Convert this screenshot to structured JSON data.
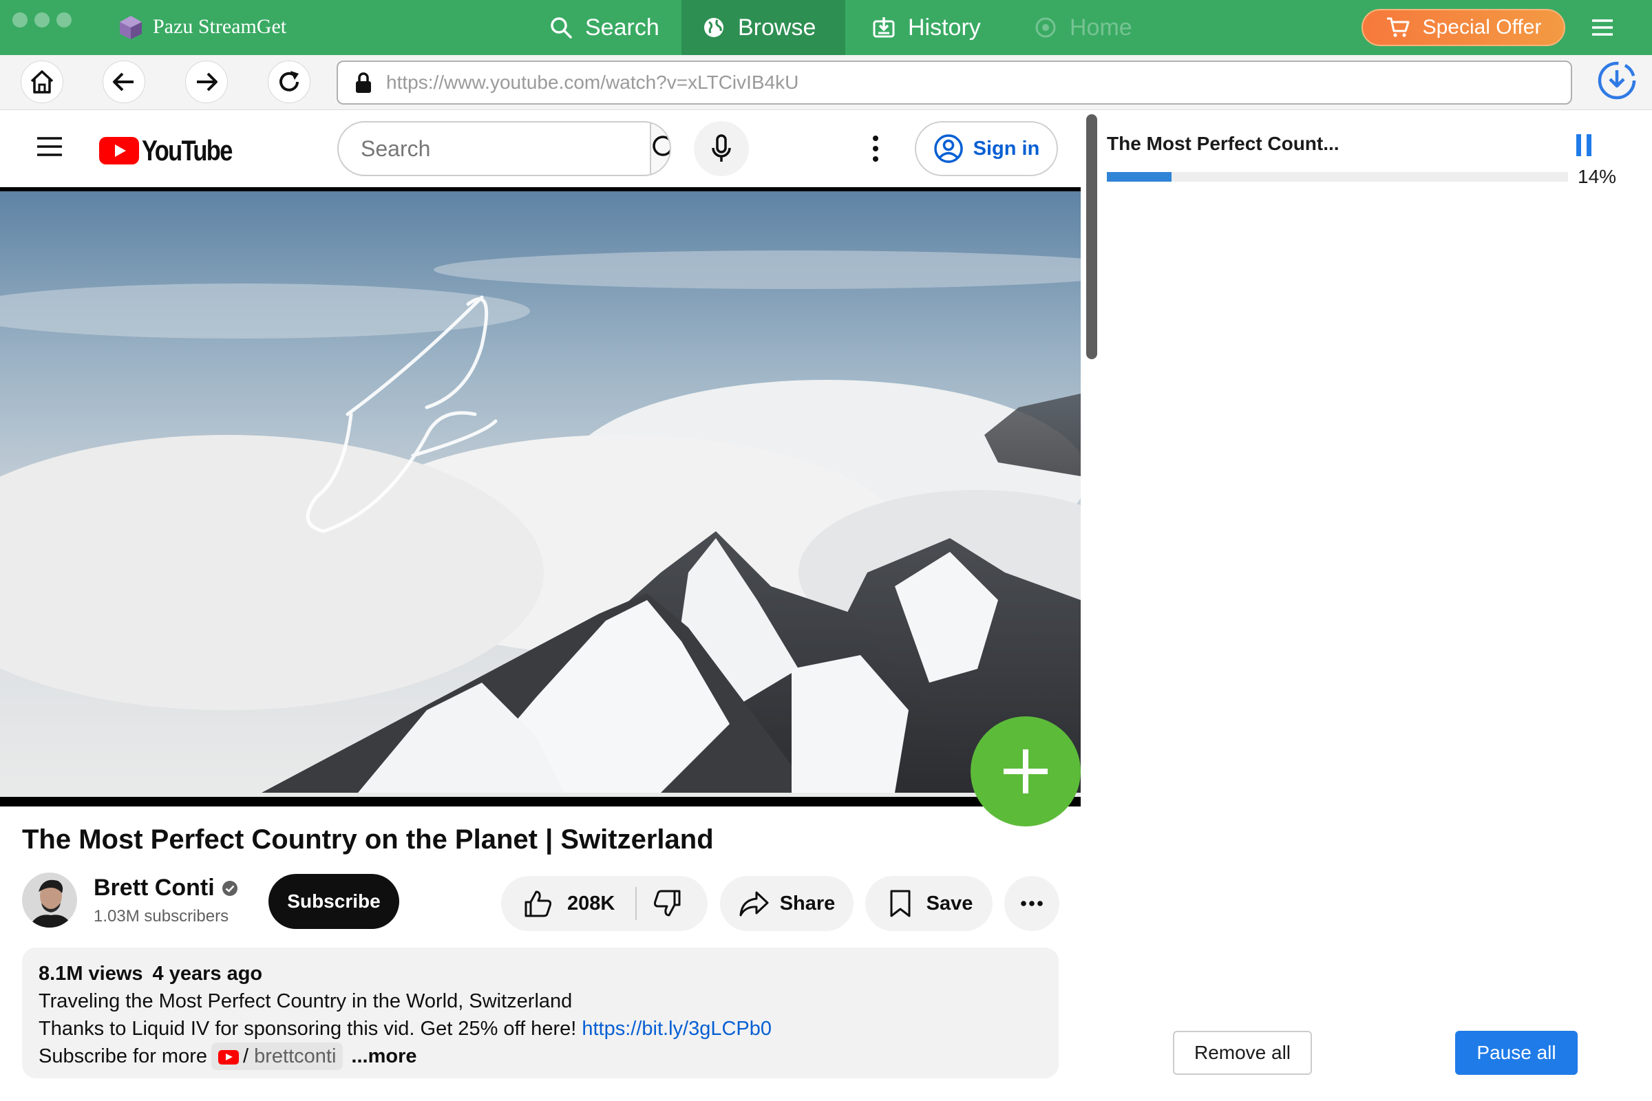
{
  "app": {
    "name": "Pazu StreamGet",
    "nav": [
      {
        "label": "Search",
        "icon": "search-icon"
      },
      {
        "label": "Browse",
        "icon": "globe-icon",
        "active": true
      },
      {
        "label": "History",
        "icon": "download-history-icon"
      },
      {
        "label": "Home",
        "icon": "home-icon",
        "disabled": true
      }
    ],
    "special_offer_label": "Special Offer",
    "brand_color": "#3aaa63"
  },
  "address_bar": {
    "url": "https://www.youtube.com/watch?v=xLTCivIB4kU"
  },
  "youtube": {
    "logo_text": "YouTube",
    "search_placeholder": "Search",
    "sign_in_label": "Sign in",
    "video": {
      "title": "The Most Perfect Country on the Planet | Switzerland"
    },
    "channel": {
      "name": "Brett Conti",
      "subscribers": "1.03M subscribers",
      "subscribe_label": "Subscribe"
    },
    "actions": {
      "likes": "208K",
      "share_label": "Share",
      "save_label": "Save"
    },
    "description": {
      "views": "8.1M views",
      "age": "4 years ago",
      "line1": "Traveling the Most Perfect Country in the World, Switzerland",
      "line2_text": "Thanks to Liquid IV for sponsoring this vid. Get 25% off here!",
      "line2_link": "https://bit.ly/3gLCPb0",
      "line3_text": "Subscribe for more",
      "line3_slash": "/",
      "line3_handle": "brettconti",
      "more_label": "...more"
    }
  },
  "downloads": {
    "items": [
      {
        "title": "The Most Perfect Count...",
        "percent_label": "14%",
        "progress": 0.14
      }
    ],
    "remove_all_label": "Remove all",
    "pause_all_label": "Pause all",
    "accent_color": "#1f7be8"
  }
}
